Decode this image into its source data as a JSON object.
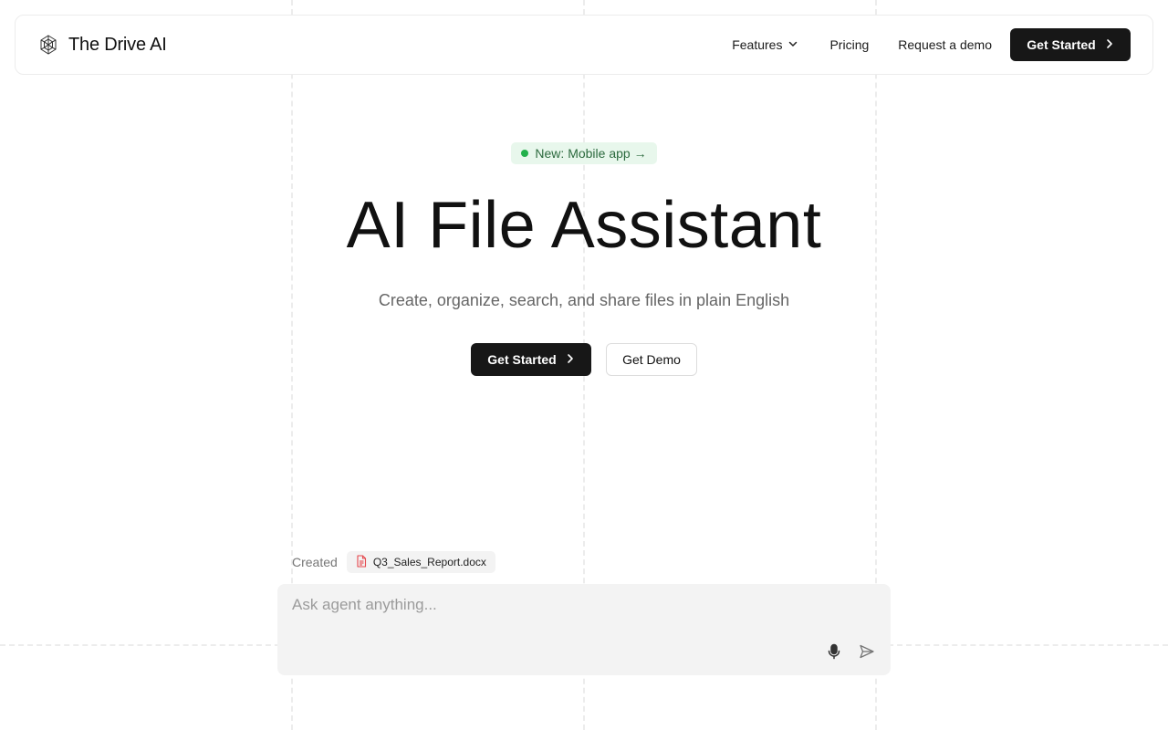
{
  "brand": {
    "name": "The Drive AI",
    "logo_icon": "brain-icon"
  },
  "nav": {
    "features_label": "Features",
    "pricing_label": "Pricing",
    "demo_label": "Request a demo",
    "cta_label": "Get Started"
  },
  "hero": {
    "badge_label": "New: Mobile app →",
    "title": "AI File Assistant",
    "subtitle": "Create, organize, search, and share files in plain English",
    "primary_cta": "Get Started",
    "secondary_cta": "Get Demo"
  },
  "activity": {
    "created_label": "Created",
    "file_name": "Q3_Sales_Report.docx"
  },
  "prompt": {
    "placeholder": "Ask agent anything..."
  },
  "colors": {
    "primary_button": "#171717",
    "badge_bg": "#e8f7ec",
    "badge_dot": "#22b04b",
    "file_icon": "#e5484d",
    "prompt_bg": "#f3f3f3"
  }
}
